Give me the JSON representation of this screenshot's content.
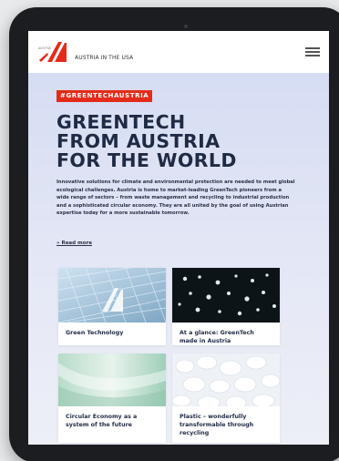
{
  "header": {
    "logo_text": "AUSTRIA",
    "site_name": "AUSTRIA IN THE USA"
  },
  "hero": {
    "tag": "#GREENTECHAUSTRIA",
    "title_lines": [
      "GREENTECH",
      "FROM AUSTRIA",
      "FOR THE WORLD"
    ],
    "intro": "Innovative solutions for climate and environmental protection are needed to meet global ecological challenges. Austria is home to market-leading GreenTech pioneers from a wide range of sectors – from waste management and recycling to industrial production and a sophisticated circular economy. They are all united by the goal of using Austrian expertise today for a more sustainable tomorrow.",
    "read_more": "» Read more"
  },
  "cards": [
    {
      "label": "Green Technology"
    },
    {
      "label": "At a glance: GreenTech made in Austria"
    },
    {
      "label": "Circular Economy as a system of the future"
    },
    {
      "label": "Plastic – wonderfully transformable through recycling"
    }
  ],
  "colors": {
    "accent": "#e42b1a",
    "heading": "#1f2a44",
    "device_frame": "#1c1d20"
  },
  "icons": {
    "menu": "hamburger-menu-icon",
    "logo": "austria-logo"
  }
}
